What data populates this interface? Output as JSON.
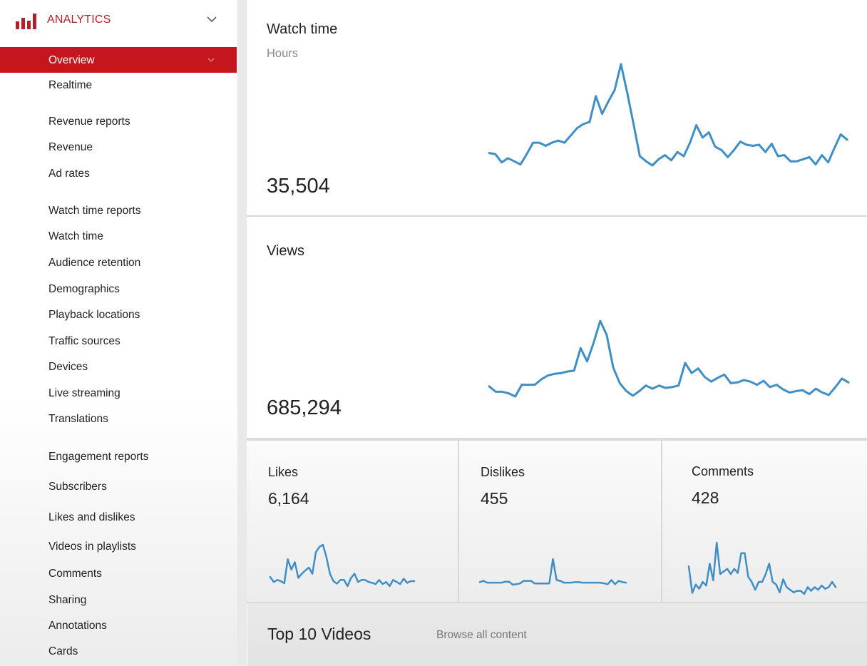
{
  "sidebar": {
    "title": "ANALYTICS",
    "logo_icon": "analytics-bars-icon",
    "brand_color": "#c4161c",
    "items": [
      {
        "label": "Overview",
        "active": true
      },
      {
        "label": "Realtime"
      },
      {
        "label": "Revenue reports"
      },
      {
        "label": "Revenue"
      },
      {
        "label": "Ad rates"
      },
      {
        "label": "Watch time reports"
      },
      {
        "label": "Watch time"
      },
      {
        "label": "Audience retention"
      },
      {
        "label": "Demographics"
      },
      {
        "label": "Playback locations"
      },
      {
        "label": "Traffic sources"
      },
      {
        "label": "Devices"
      },
      {
        "label": "Live streaming"
      },
      {
        "label": "Translations"
      },
      {
        "label": "Engagement reports"
      },
      {
        "label": "Subscribers"
      },
      {
        "label": "Likes and dislikes"
      },
      {
        "label": "Videos in playlists"
      },
      {
        "label": "Comments"
      },
      {
        "label": "Sharing"
      },
      {
        "label": "Annotations"
      },
      {
        "label": "Cards"
      }
    ]
  },
  "main": {
    "watch_time": {
      "title": "Watch time",
      "unit": "Hours",
      "value": "35,504"
    },
    "views": {
      "title": "Views",
      "value": "685,294"
    },
    "likes": {
      "title": "Likes",
      "value": "6,164"
    },
    "dislikes": {
      "title": "Dislikes",
      "value": "455"
    },
    "comments": {
      "title": "Comments",
      "value": "428"
    },
    "top_videos": {
      "title": "Top 10 Videos",
      "link": "Browse all content"
    }
  },
  "chart_data": [
    {
      "type": "line",
      "title": "Watch time",
      "ylabel": "Hours",
      "series": [
        {
          "name": "Watch time",
          "values": [
            14,
            13,
            5,
            9,
            6,
            3,
            13,
            24,
            24,
            21,
            24,
            26,
            24,
            31,
            38,
            42,
            44,
            69,
            52,
            64,
            75,
            100,
            72,
            42,
            11,
            6,
            2,
            8,
            12,
            7,
            15,
            11,
            24,
            41,
            29,
            34,
            20,
            17,
            10,
            17,
            25,
            22,
            21,
            22,
            15,
            23,
            11,
            12,
            6,
            6,
            8,
            10,
            3,
            12,
            5,
            19,
            32,
            27
          ]
        }
      ],
      "color": "#3f8fc6"
    },
    {
      "type": "line",
      "title": "Views",
      "series": [
        {
          "name": "Views",
          "values": [
            16,
            9,
            9,
            7,
            3,
            18,
            18,
            18,
            25,
            30,
            32,
            33,
            35,
            36,
            65,
            48,
            72,
            100,
            82,
            40,
            20,
            10,
            4,
            10,
            17,
            13,
            17,
            14,
            15,
            17,
            46,
            33,
            39,
            28,
            22,
            27,
            31,
            20,
            21,
            24,
            22,
            18,
            23,
            15,
            18,
            12,
            8,
            10,
            11,
            6,
            13,
            8,
            5,
            15,
            26,
            21
          ]
        }
      ],
      "color": "#3f8fc6"
    },
    {
      "type": "line",
      "title": "Likes",
      "series": [
        {
          "name": "Likes",
          "values": [
            22,
            10,
            15,
            12,
            7,
            65,
            40,
            58,
            20,
            30,
            38,
            45,
            30,
            82,
            95,
            100,
            70,
            30,
            12,
            6,
            15,
            15,
            0,
            20,
            30,
            10,
            15,
            15,
            10,
            8,
            5,
            15,
            5,
            10,
            0,
            15,
            10,
            5,
            18,
            8,
            12,
            12
          ]
        }
      ],
      "color": "#3f8fc6"
    },
    {
      "type": "line",
      "title": "Dislikes",
      "series": [
        {
          "name": "Dislikes",
          "values": [
            10,
            15,
            8,
            8,
            8,
            8,
            8,
            12,
            12,
            0,
            2,
            5,
            15,
            15,
            15,
            5,
            5,
            5,
            5,
            5,
            100,
            18,
            15,
            8,
            8,
            8,
            10,
            10,
            8,
            8,
            8,
            8,
            8,
            8,
            5,
            2,
            18,
            2,
            15,
            10,
            8
          ]
        }
      ],
      "color": "#3f8fc6"
    },
    {
      "type": "line",
      "title": "Comments",
      "series": [
        {
          "name": "Comments",
          "values": [
            55,
            4,
            20,
            12,
            25,
            18,
            60,
            28,
            100,
            40,
            45,
            50,
            40,
            50,
            42,
            80,
            80,
            35,
            25,
            10,
            25,
            25,
            40,
            60,
            25,
            20,
            5,
            30,
            15,
            10,
            5,
            8,
            8,
            2,
            15,
            8,
            15,
            10,
            18,
            12,
            15,
            25,
            15
          ]
        }
      ],
      "color": "#3f8fc6"
    }
  ]
}
